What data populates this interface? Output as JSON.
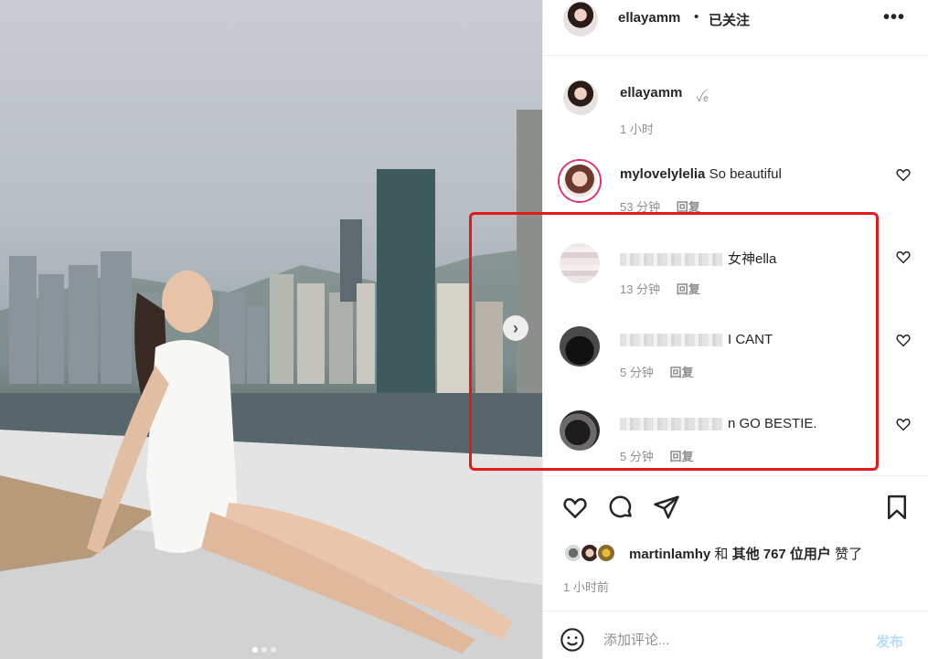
{
  "header": {
    "username": "ellayamm",
    "separator": "•",
    "follow_status": "已关注",
    "more_label": "•••"
  },
  "caption": {
    "username": "ellayamm",
    "emoji": "ꪜꫀ",
    "time": "1 小时"
  },
  "comments": [
    {
      "username": "mylovelylelia",
      "text": "So beautiful",
      "time": "53 分钟",
      "reply": "回复"
    },
    {
      "username": "",
      "text": "女神ella",
      "time": "13 分钟",
      "reply": "回复"
    },
    {
      "username": "",
      "text": "I CANT",
      "time": "5 分钟",
      "reply": "回复"
    },
    {
      "username": "",
      "text": "n GO BESTIE.",
      "time": "5 分钟",
      "reply": "回复"
    }
  ],
  "likes": {
    "user": "martinlamhy",
    "connector": "和",
    "others": "其他 767 位用户",
    "suffix": "赞了"
  },
  "post_time": "1 小时前",
  "composer": {
    "placeholder": "添加评论...",
    "post_label": "发布"
  },
  "carousel": {
    "current_slide": 1,
    "total_slides": 3
  },
  "colors": {
    "highlight": "#e31a1a",
    "post_disabled": "#b2dffc"
  }
}
